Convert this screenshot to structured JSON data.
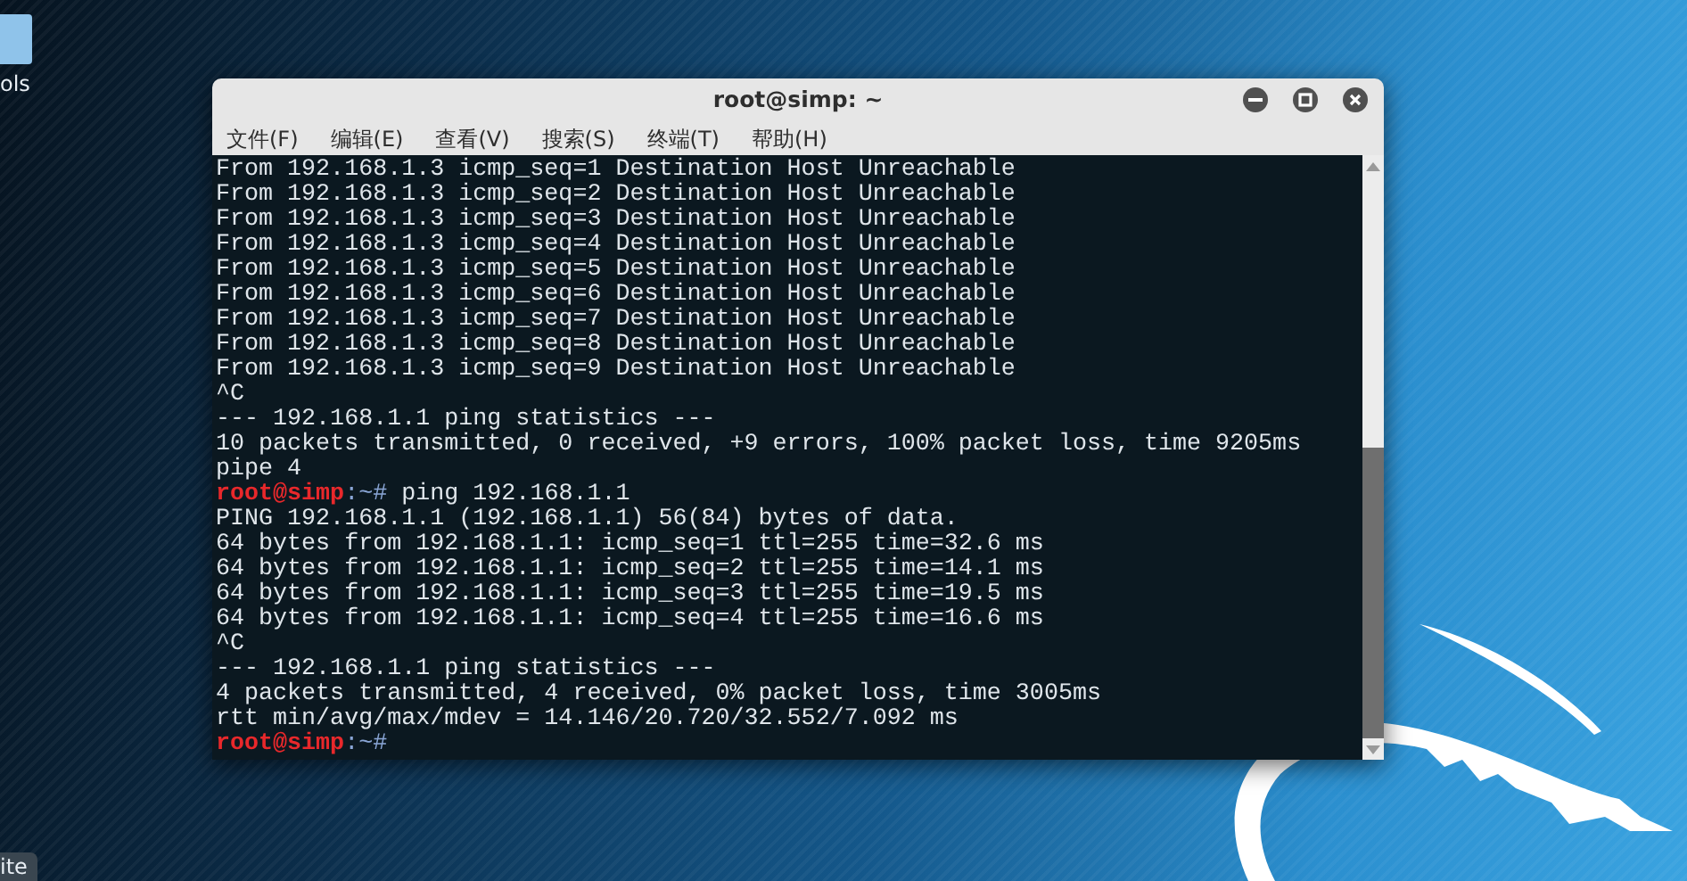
{
  "desktop_icons": [
    {
      "label": "ols",
      "kind": "folder"
    },
    {
      "label": "ite",
      "kind": "label"
    }
  ],
  "window": {
    "title": "root@simp: ~",
    "menu": [
      "文件(F)",
      "编辑(E)",
      "查看(V)",
      "搜索(S)",
      "终端(T)",
      "帮助(H)"
    ],
    "terminal": [
      {
        "kind": "output",
        "text": "From 192.168.1.3 icmp_seq=1 Destination Host Unreachable"
      },
      {
        "kind": "output",
        "text": "From 192.168.1.3 icmp_seq=2 Destination Host Unreachable"
      },
      {
        "kind": "output",
        "text": "From 192.168.1.3 icmp_seq=3 Destination Host Unreachable"
      },
      {
        "kind": "output",
        "text": "From 192.168.1.3 icmp_seq=4 Destination Host Unreachable"
      },
      {
        "kind": "output",
        "text": "From 192.168.1.3 icmp_seq=5 Destination Host Unreachable"
      },
      {
        "kind": "output",
        "text": "From 192.168.1.3 icmp_seq=6 Destination Host Unreachable"
      },
      {
        "kind": "output",
        "text": "From 192.168.1.3 icmp_seq=7 Destination Host Unreachable"
      },
      {
        "kind": "output",
        "text": "From 192.168.1.3 icmp_seq=8 Destination Host Unreachable"
      },
      {
        "kind": "output",
        "text": "From 192.168.1.3 icmp_seq=9 Destination Host Unreachable"
      },
      {
        "kind": "output",
        "text": "^C"
      },
      {
        "kind": "output",
        "text": "--- 192.168.1.1 ping statistics ---"
      },
      {
        "kind": "output",
        "text": "10 packets transmitted, 0 received, +9 errors, 100% packet loss, time 9205ms"
      },
      {
        "kind": "output",
        "text": "pipe 4"
      },
      {
        "kind": "prompt",
        "user": "root@simp",
        "path": ":~#",
        "command": "ping 192.168.1.1"
      },
      {
        "kind": "output",
        "text": "PING 192.168.1.1 (192.168.1.1) 56(84) bytes of data."
      },
      {
        "kind": "output",
        "text": "64 bytes from 192.168.1.1: icmp_seq=1 ttl=255 time=32.6 ms"
      },
      {
        "kind": "output",
        "text": "64 bytes from 192.168.1.1: icmp_seq=2 ttl=255 time=14.1 ms"
      },
      {
        "kind": "output",
        "text": "64 bytes from 192.168.1.1: icmp_seq=3 ttl=255 time=19.5 ms"
      },
      {
        "kind": "output",
        "text": "64 bytes from 192.168.1.1: icmp_seq=4 ttl=255 time=16.6 ms"
      },
      {
        "kind": "output",
        "text": "^C"
      },
      {
        "kind": "output",
        "text": "--- 192.168.1.1 ping statistics ---"
      },
      {
        "kind": "output",
        "text": "4 packets transmitted, 4 received, 0% packet loss, time 3005ms"
      },
      {
        "kind": "output",
        "text": "rtt min/avg/max/mdev = 14.146/20.720/32.552/7.092 ms"
      },
      {
        "kind": "prompt",
        "user": "root@simp",
        "path": ":~#"
      }
    ]
  }
}
